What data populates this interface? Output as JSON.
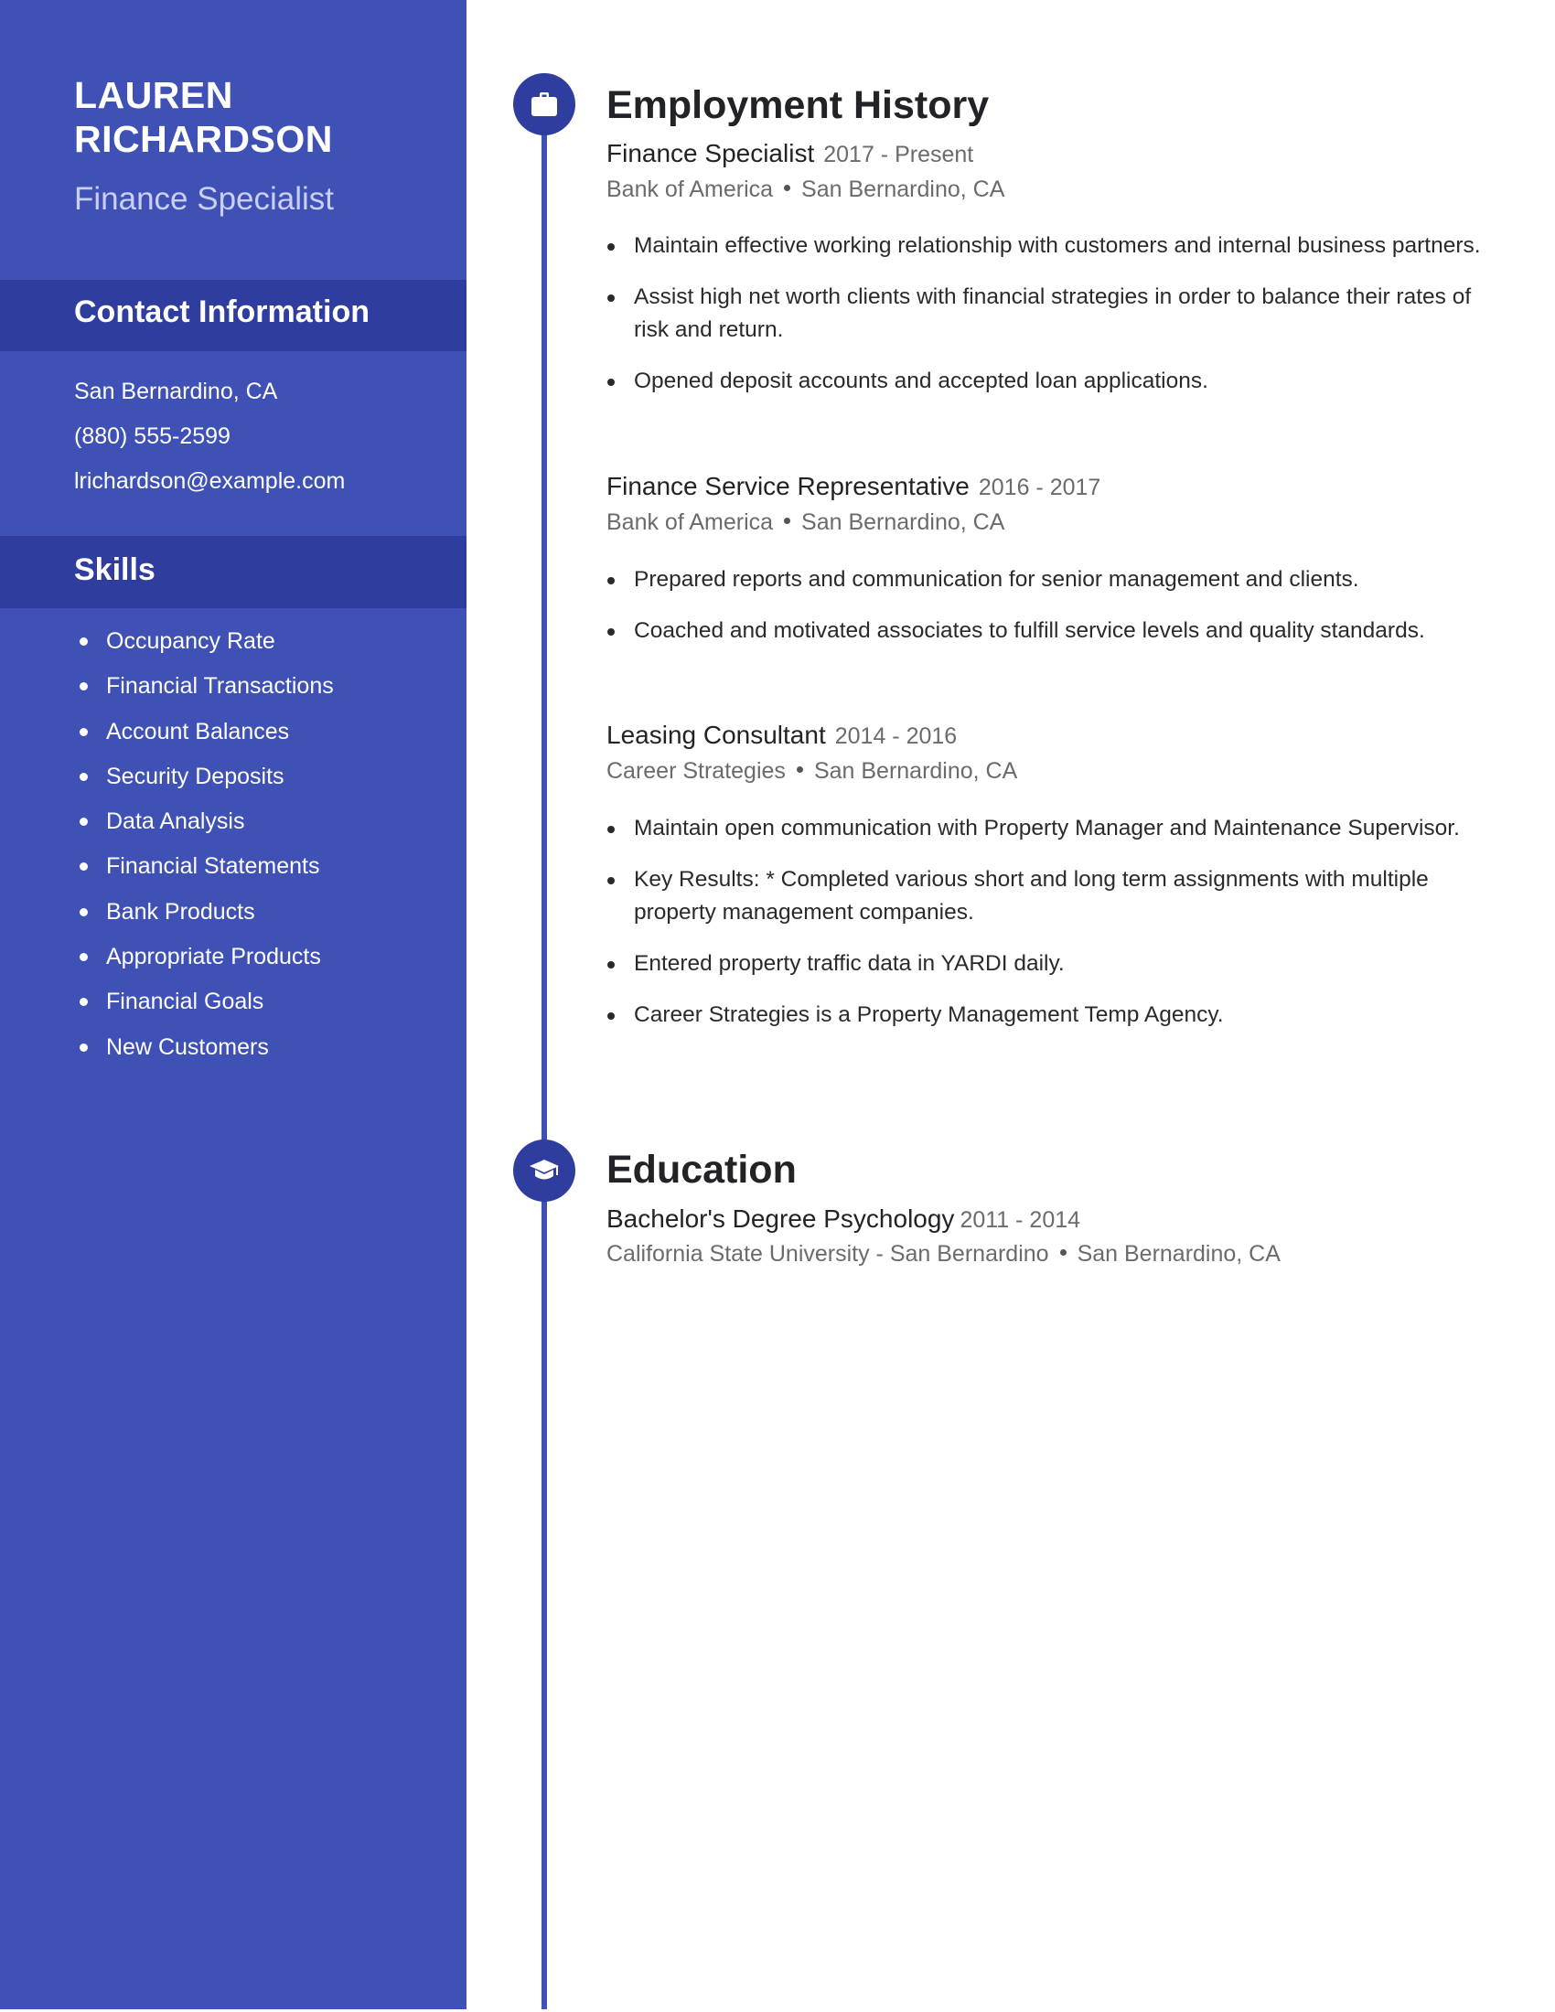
{
  "profile": {
    "first_name": "LAUREN",
    "last_name": "RICHARDSON",
    "title": "Finance Specialist"
  },
  "contact": {
    "heading": "Contact Information",
    "items": [
      "San Bernardino, CA",
      "(880) 555-2599",
      "lrichardson@example.com"
    ]
  },
  "skills": {
    "heading": "Skills",
    "items": [
      "Occupancy Rate",
      "Financial Transactions",
      "Account Balances",
      "Security Deposits",
      "Data Analysis",
      "Financial Statements",
      "Bank Products",
      "Appropriate Products",
      "Financial Goals",
      "New Customers"
    ]
  },
  "employment": {
    "heading": "Employment History",
    "icon": "briefcase-icon",
    "jobs": [
      {
        "title": "Finance Specialist",
        "dates": "2017 - Present",
        "company": "Bank of America",
        "location": "San Bernardino, CA",
        "bullets": [
          "Maintain effective working relationship with customers and internal business partners.",
          "Assist high net worth clients with financial strategies in order to balance their rates of risk and return.",
          "Opened deposit accounts and accepted loan applications."
        ]
      },
      {
        "title": "Finance Service Representative",
        "dates": "2016 - 2017",
        "company": "Bank of America",
        "location": "San Bernardino, CA",
        "bullets": [
          "Prepared reports and communication for senior management and clients.",
          "Coached and motivated associates to fulfill service levels and quality standards."
        ]
      },
      {
        "title": "Leasing Consultant",
        "dates": "2014 - 2016",
        "company": "Career Strategies",
        "location": "San Bernardino, CA",
        "bullets": [
          "Maintain open communication with Property Manager and Maintenance Supervisor.",
          "Key Results: * Completed various short and long term assignments with multiple property management companies.",
          "Entered property traffic data in YARDI daily.",
          "Career Strategies is a Property Management Temp Agency."
        ]
      }
    ]
  },
  "education": {
    "heading": "Education",
    "icon": "graduation-cap-icon",
    "entries": [
      {
        "degree": "Bachelor's Degree Psychology",
        "dates": "2011 - 2014",
        "school": "California State University - San Bernardino",
        "location": "San Bernardino, CA"
      }
    ]
  },
  "colors": {
    "sidebar": "#3f51b5",
    "band": "#2f3d9f",
    "text_dark": "#222326",
    "text_muted": "#6b6b6b"
  }
}
